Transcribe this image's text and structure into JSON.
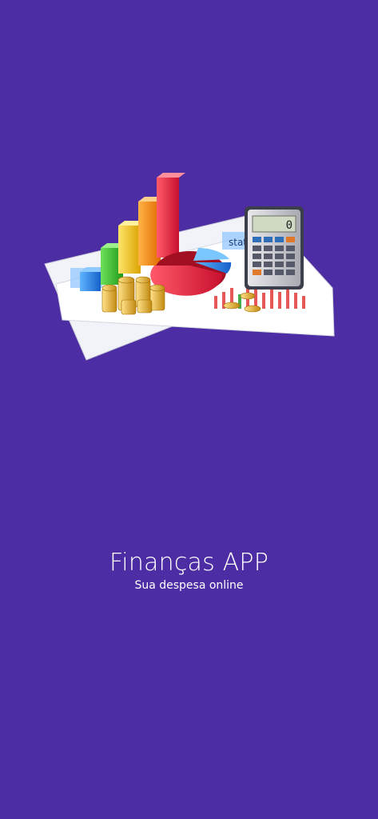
{
  "app": {
    "title": "Finanças APP",
    "subtitle": "Sua despesa online"
  },
  "hero_image": {
    "icon": "finance-charts-calculator-coins-illustration",
    "calculator_display": "0",
    "paper_label": "stats"
  },
  "colors": {
    "background": "#4d2da3",
    "text": "#ffffff"
  }
}
